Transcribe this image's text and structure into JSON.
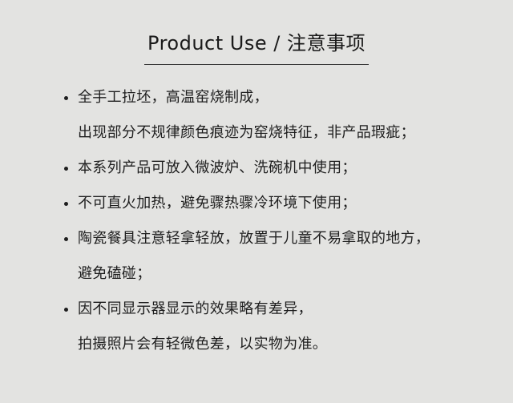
{
  "header": {
    "title": "Product Use / 注意事项"
  },
  "notes": [
    {
      "lines": [
        "全手工拉坯，高温窑烧制成，",
        "出现部分不规律颜色痕迹为窑烧特征，非产品瑕疵；"
      ]
    },
    {
      "lines": [
        "本系列产品可放入微波炉、洗碗机中使用；"
      ]
    },
    {
      "lines": [
        "不可直火加热，避免骤热骤冷环境下使用；"
      ]
    },
    {
      "lines": [
        "陶瓷餐具注意轻拿轻放，放置于儿童不易拿取的地方，",
        "避免磕碰；"
      ]
    },
    {
      "lines": [
        "因不同显示器显示的效果略有差异，",
        "拍摄照片会有轻微色差，以实物为准。"
      ]
    }
  ]
}
